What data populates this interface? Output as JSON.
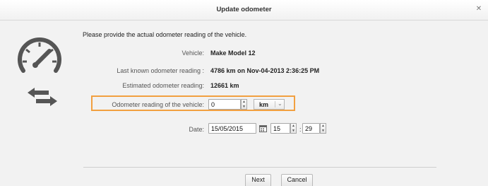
{
  "dialog": {
    "title": "Update odometer",
    "close_glyph": "✕"
  },
  "icons": {
    "gauge": "speedometer-icon",
    "swap": "swap-arrows-icon",
    "calendar": "calendar-icon"
  },
  "intro": "Please provide the actual odometer reading of the vehicle.",
  "fields": {
    "vehicle_label": "Vehicle:",
    "vehicle_value": "Make Model 12",
    "last_label": "Last known odometer reading :",
    "last_value": "4786 km on Nov-04-2013 2:36:25 PM",
    "estimated_label": "Estimated odometer reading:",
    "estimated_value": "12661 km",
    "reading_label": "Odometer reading of the vehicle:",
    "reading_value": "0",
    "unit_value": "km",
    "date_label": "Date:",
    "date_value": "15/05/2015",
    "hour_value": "15",
    "minute_value": "29",
    "time_separator": ":"
  },
  "buttons": {
    "next": "Next",
    "cancel": "Cancel"
  },
  "colors": {
    "highlight": "#f2a040",
    "icon": "#555555"
  }
}
